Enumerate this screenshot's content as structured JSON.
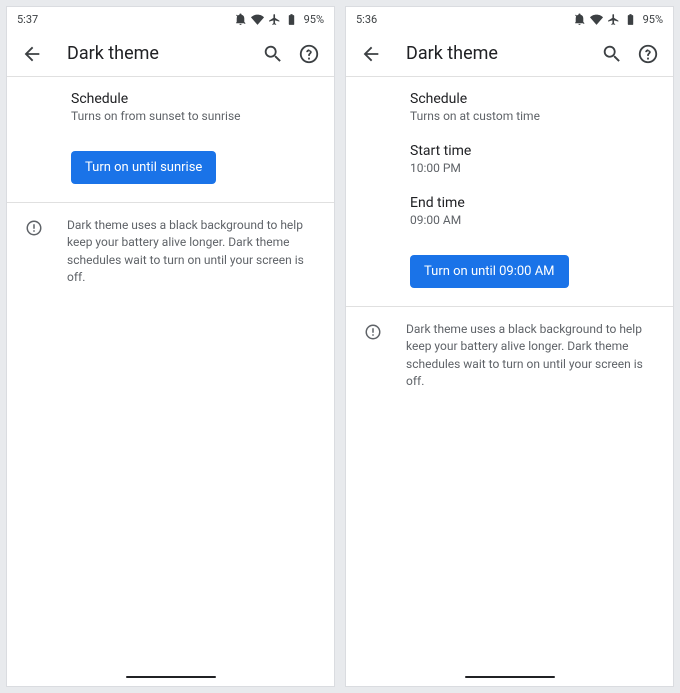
{
  "left": {
    "status": {
      "time": "5:37",
      "battery": "95%"
    },
    "appbar": {
      "title": "Dark theme"
    },
    "schedule": {
      "title": "Schedule",
      "sub": "Turns on from sunset to sunrise"
    },
    "button": "Turn on until sunrise",
    "info": "Dark theme uses a black background to help keep your battery alive longer. Dark theme schedules wait to turn on until your screen is off."
  },
  "right": {
    "status": {
      "time": "5:36",
      "battery": "95%"
    },
    "appbar": {
      "title": "Dark theme"
    },
    "schedule": {
      "title": "Schedule",
      "sub": "Turns on at custom time"
    },
    "start": {
      "title": "Start time",
      "sub": "10:00 PM"
    },
    "end": {
      "title": "End time",
      "sub": "09:00 AM"
    },
    "button": "Turn on until 09:00 AM",
    "info": "Dark theme uses a black background to help keep your battery alive longer. Dark theme schedules wait to turn on until your screen is off."
  }
}
